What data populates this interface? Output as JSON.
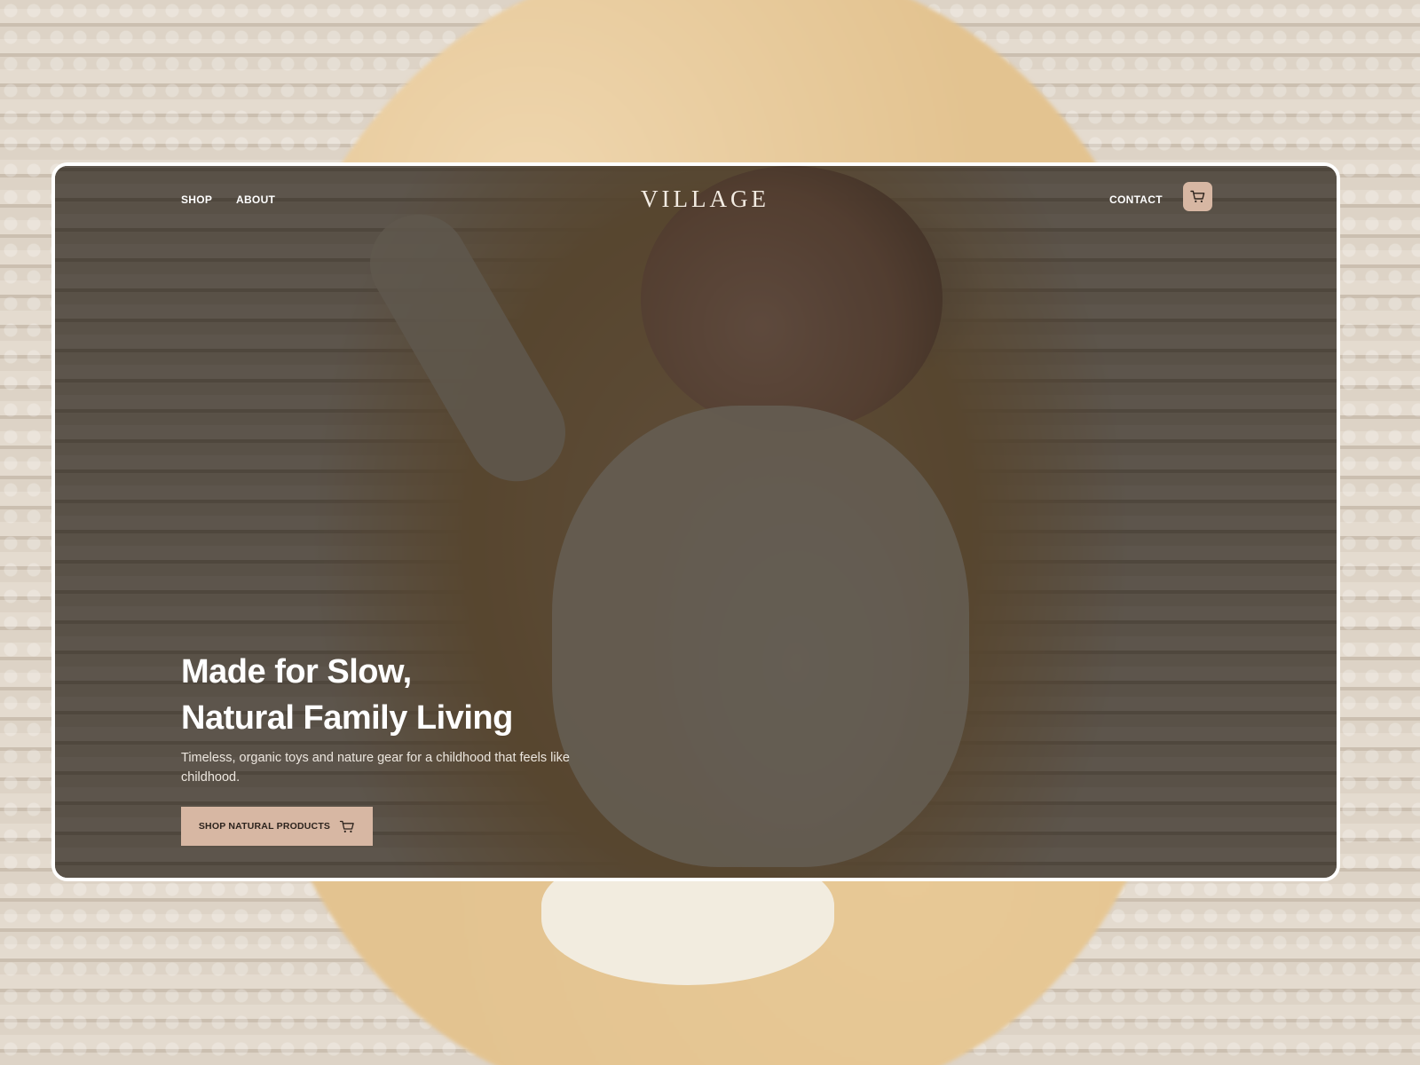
{
  "nav": {
    "shop_label": "SHOP",
    "about_label": "ABOUT",
    "contact_label": "CONTACT",
    "cart_icon": "cart-icon"
  },
  "brand": {
    "logo_text": "VILLAGE"
  },
  "hero": {
    "title_line1": "Made for Slow,",
    "title_line2": "Natural Family Living",
    "subtitle": "Timeless, organic toys and nature gear for a childhood that feels like childhood.",
    "cta_label": "SHOP NATURAL PRODUCTS",
    "cta_icon": "cart-icon"
  },
  "colors": {
    "accent": "#d7b7a3",
    "frame_border": "#ffffff",
    "overlay": "#1e1812",
    "text_primary": "#ffffff",
    "cta_text": "#2c231d"
  }
}
